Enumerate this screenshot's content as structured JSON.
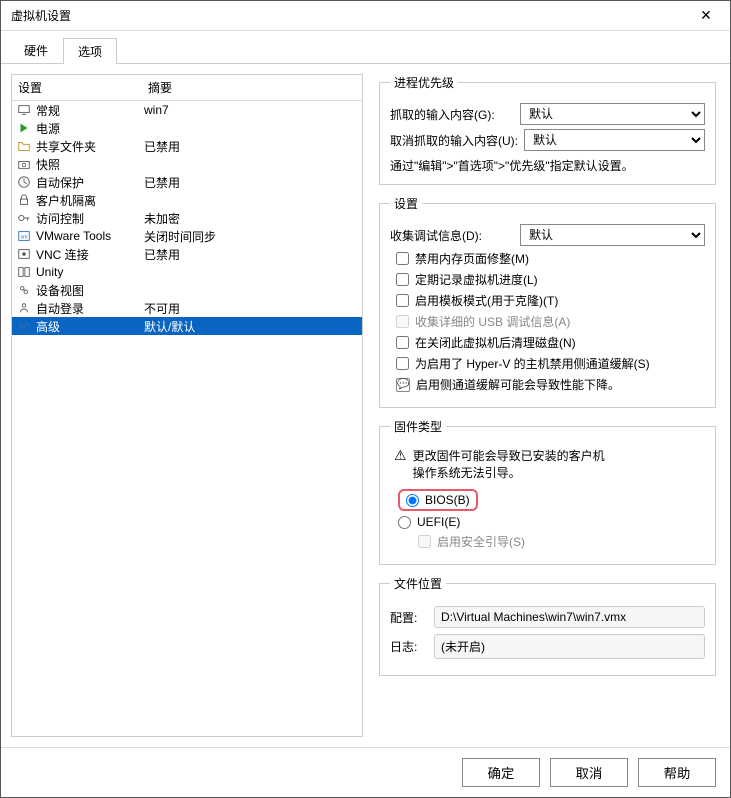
{
  "window": {
    "title": "虚拟机设置"
  },
  "tabs": {
    "hardware": "硬件",
    "options": "选项"
  },
  "table": {
    "header_setting": "设置",
    "header_summary": "摘要",
    "rows": [
      {
        "icon": "monitor",
        "name": "常规",
        "summary": "win7"
      },
      {
        "icon": "power",
        "name": "电源",
        "summary": ""
      },
      {
        "icon": "folder",
        "name": "共享文件夹",
        "summary": "已禁用"
      },
      {
        "icon": "camera",
        "name": "快照",
        "summary": ""
      },
      {
        "icon": "clock",
        "name": "自动保护",
        "summary": "已禁用"
      },
      {
        "icon": "lock",
        "name": "客户机隔离",
        "summary": ""
      },
      {
        "icon": "key",
        "name": "访问控制",
        "summary": "未加密"
      },
      {
        "icon": "vm",
        "name": "VMware Tools",
        "summary": "关闭时间同步"
      },
      {
        "icon": "vnc",
        "name": "VNC 连接",
        "summary": "已禁用"
      },
      {
        "icon": "unity",
        "name": "Unity",
        "summary": ""
      },
      {
        "icon": "device",
        "name": "设备视图",
        "summary": ""
      },
      {
        "icon": "auto",
        "name": "自动登录",
        "summary": "不可用"
      },
      {
        "icon": "adv",
        "name": "高级",
        "summary": "默认/默认"
      }
    ],
    "selected_index": 12
  },
  "priority": {
    "legend": "进程优先级",
    "captured_label": "抓取的输入内容(G):",
    "released_label": "取消抓取的输入内容(U):",
    "default_option": "默认",
    "note": "通过\"编辑\">\"首选项\">\"优先级\"指定默认设置。"
  },
  "settings": {
    "legend": "设置",
    "debug_label": "收集调试信息(D):",
    "default_option": "默认",
    "chk_mem": "禁用内存页面修整(M)",
    "chk_log": "定期记录虚拟机进度(L)",
    "chk_template": "启用模板模式(用于克隆)(T)",
    "chk_usb": "收集详细的 USB 调试信息(A)",
    "chk_clean": "在关闭此虚拟机后清理磁盘(N)",
    "chk_hyperv": "为启用了 Hyper-V 的主机禁用侧通道缓解(S)",
    "info_text": "启用侧通道缓解可能会导致性能下降。"
  },
  "firmware": {
    "legend": "固件类型",
    "warning_l1": "更改固件可能会导致已安装的客户机",
    "warning_l2": "操作系统无法引导。",
    "bios_label": "BIOS(B)",
    "uefi_label": "UEFI(E)",
    "secureboot_label": "启用安全引导(S)"
  },
  "filelocation": {
    "legend": "文件位置",
    "config_label": "配置:",
    "config_value": "D:\\Virtual Machines\\win7\\win7.vmx",
    "log_label": "日志:",
    "log_value": "(未开启)"
  },
  "footer": {
    "ok": "确定",
    "cancel": "取消",
    "help": "帮助"
  }
}
